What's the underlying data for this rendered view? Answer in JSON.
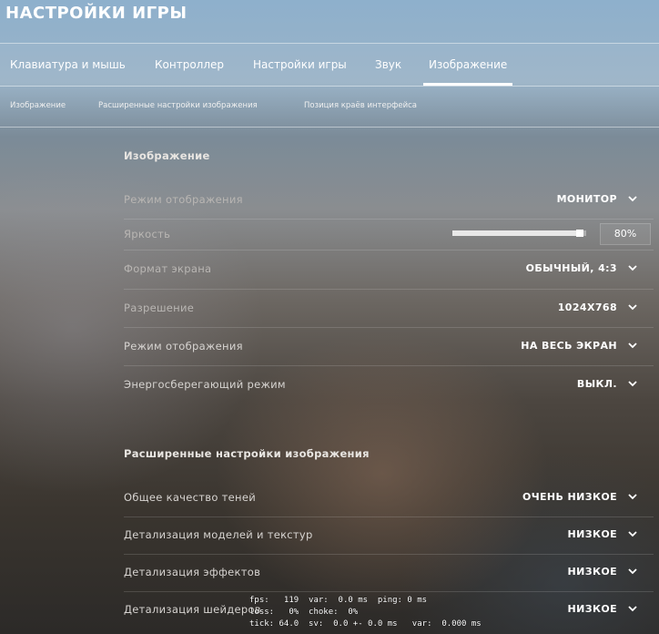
{
  "window": {
    "title": "НАСТРОЙКИ ИГРЫ"
  },
  "tabs": [
    {
      "label": "Клавиатура и мышь"
    },
    {
      "label": "Контроллер"
    },
    {
      "label": "Настройки игры"
    },
    {
      "label": "Звук"
    },
    {
      "label": "Изображение",
      "active": true
    }
  ],
  "subtabs": [
    {
      "label": "Изображение"
    },
    {
      "label": "Расширенные настройки изображения"
    },
    {
      "label": "Позиция краёв интерфейса"
    }
  ],
  "video": {
    "section_title": "Изображение",
    "rows": [
      {
        "label": "Режим отображения",
        "value": "МОНИТОР"
      },
      {
        "label": "Яркость",
        "slider_fraction": 0.8,
        "value": "80%"
      },
      {
        "label": "Формат экрана",
        "value": "ОБЫЧНЫЙ, 4:3"
      },
      {
        "label": "Разрешение",
        "value": "1024X768"
      },
      {
        "label": "Режим отображения",
        "value": "НА ВЕСЬ ЭКРАН"
      },
      {
        "label": "Энергосберегающий режим",
        "value": "ВЫКЛ."
      }
    ]
  },
  "advanced": {
    "section_title": "Расширенные настройки изображения",
    "rows": [
      {
        "label": "Общее качество теней",
        "value": "ОЧЕНЬ НИЗКОЕ"
      },
      {
        "label": "Детализация моделей и текстур",
        "value": "НИЗКОЕ"
      },
      {
        "label": "Детализация эффектов",
        "value": "НИЗКОЕ"
      },
      {
        "label": "Детализация шейдеров",
        "value": "НИЗКОЕ"
      }
    ]
  },
  "netgraph": {
    "line1": "fps:   119  var:  0.0 ms  ping: 0 ms",
    "line2": "loss:   0%  choke:  0%",
    "line3": "tick: 64.0  sv:  0.0 +- 0.0 ms   var:  0.000 ms"
  },
  "icons": {
    "dropdown": "chevron-down-icon"
  }
}
